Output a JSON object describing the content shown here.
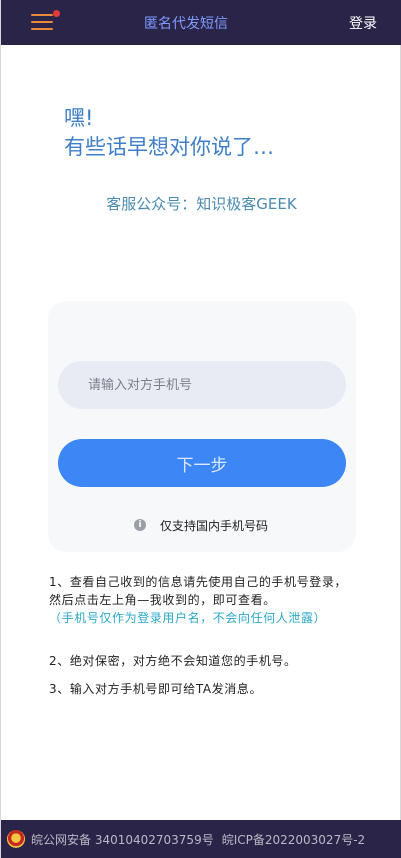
{
  "header": {
    "title": "匿名代发短信",
    "login_label": "登录",
    "menu_icon": "hamburger-menu-icon",
    "badge_color": "#e53935"
  },
  "hero": {
    "greeting_line1": "嘿!",
    "greeting_line2": "有些话早想对你说了…",
    "service_account": "客服公众号：知识极客GEEK"
  },
  "form": {
    "phone_placeholder": "请输入对方手机号",
    "phone_value": "",
    "next_label": "下一步",
    "notice": "仅支持国内手机号码",
    "info_icon": "info-icon"
  },
  "tips": {
    "tip1_main": "1、查看自己收到的信息请先使用自己的手机号登录，然后点击左上角—我收到的，即可查看。",
    "tip1_note": "（手机号仅作为登录用户名，不会向任何人泄露）",
    "tip2": "2、绝对保密，对方绝不会知道您的手机号。",
    "tip3": "3、输入对方手机号即可给TA发消息。"
  },
  "footer": {
    "police_record": "皖公网安备 34010402703759号",
    "icp_record": "皖ICP备2022003027号-2",
    "police_icon": "police-badge-icon"
  },
  "colors": {
    "topbar": "#2a2448",
    "accent_blue": "#3d86f6",
    "greeting_blue": "#3e7fc7",
    "note_cyan": "#2aa8c8",
    "menu_orange": "#e88a3a"
  }
}
